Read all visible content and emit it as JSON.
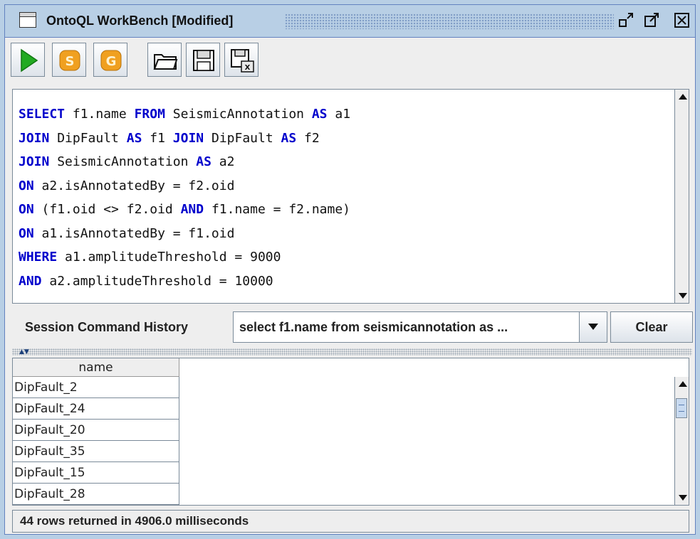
{
  "window": {
    "title": "OntoQL WorkBench [Modified]",
    "controls": [
      "restore-icon",
      "maximize-icon",
      "close-icon"
    ]
  },
  "toolbar": {
    "buttons": [
      {
        "name": "run-button",
        "icon": "play-icon"
      },
      {
        "name": "s-button",
        "icon": "s-icon",
        "letter": "S"
      },
      {
        "name": "g-button",
        "icon": "g-icon",
        "letter": "G"
      },
      {
        "name": "open-button",
        "icon": "folder-icon"
      },
      {
        "name": "save-button",
        "icon": "floppy-icon"
      },
      {
        "name": "export-button",
        "icon": "floppy-export-icon"
      }
    ]
  },
  "editor": {
    "lines": [
      {
        "kw1": "SELECT",
        "t1": " f1.name ",
        "kw2": "FROM",
        "t2": " SeismicAnnotation ",
        "kw3": "AS",
        "t3": " a1"
      },
      {
        "kw1": "JOIN",
        "t1": " DipFault ",
        "kw2": "AS",
        "t2": " f1 ",
        "kw3": "JOIN",
        "t3": " DipFault ",
        "kw4": "AS",
        "t4": " f2"
      },
      {
        "kw1": "JOIN",
        "t1": " SeismicAnnotation ",
        "kw2": "AS",
        "t2": " a2"
      },
      {
        "kw1": "ON",
        "t1": " a2.isAnnotatedBy = f2.oid"
      },
      {
        "kw1": "ON",
        "t1": " (f1.oid <> f2.oid ",
        "kw2": "AND",
        "t2": " f1.name = f2.name)"
      },
      {
        "kw1": "ON",
        "t1": " a1.isAnnotatedBy = f1.oid"
      },
      {
        "kw1": "WHERE",
        "t1": " a1.amplitudeThreshold = 9000"
      },
      {
        "kw1": "AND",
        "t1": " a2.amplitudeThreshold = 10000"
      }
    ]
  },
  "history": {
    "label": "Session Command History",
    "selected": "select f1.name from seismicannotation as ...",
    "clear_label": "Clear"
  },
  "results": {
    "columns": [
      "name"
    ],
    "rows": [
      "DipFault_2",
      "DipFault_24",
      "DipFault_20",
      "DipFault_35",
      "DipFault_15",
      "DipFault_28"
    ]
  },
  "status": {
    "text": "44 rows returned in 4906.0 milliseconds"
  },
  "colors": {
    "keyword": "#0000cc",
    "titlebar": "#b8cfe5",
    "run_green": "#22aa22",
    "sg_orange": "#f0a020"
  }
}
